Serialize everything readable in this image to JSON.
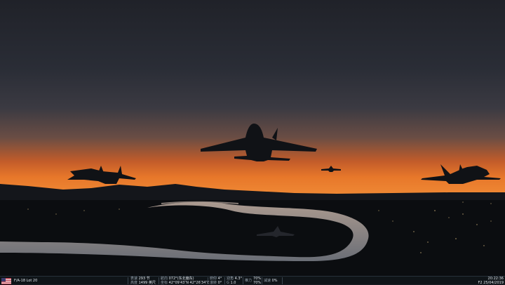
{
  "hud": {
    "flag_icon": "us-flag-icon",
    "aircraft": "F/A-18 Lot 20",
    "speed_label": "表速",
    "speed_value": "293 节",
    "alt_label": "高度",
    "alt_value": "1499 英尺",
    "heading_label": "航向",
    "heading_value": "072°(东北偏东)",
    "coord_label": "坐标",
    "coord_value": "42°09′43″N 42°26′34″E",
    "pitch_label": "俯仰",
    "pitch_value": "4°",
    "roll_label": "滚转",
    "roll_value": "0°",
    "aoa_label": "迎角",
    "aoa_value": "4.3°",
    "g_label": "G",
    "g_value": "1.0",
    "thrust_label": "推力",
    "thrust_value_1": "70%",
    "thrust_value_2": "70%",
    "brake_label": "减速",
    "brake_value": "0%",
    "time": "20:22:36",
    "date": "F2 25/04/2019"
  },
  "colors": {
    "sky_top": "#22242c",
    "sky_horizon": "#e06a22",
    "ground": "#0b0d10",
    "river": "#b9a8a0"
  }
}
